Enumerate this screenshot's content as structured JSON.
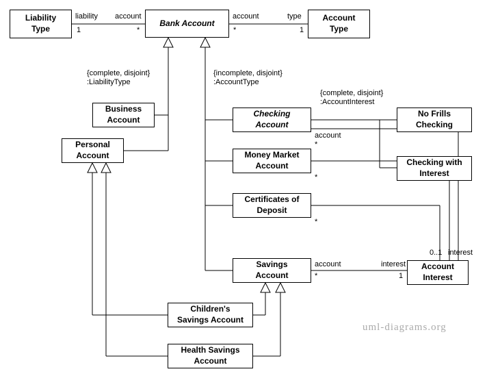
{
  "classes": {
    "liability_type": "Liability<br>Type",
    "bank_account": "Bank Account",
    "account_type": "Account<br>Type",
    "business_account": "Business<br>Account",
    "personal_account": "Personal<br>Account",
    "checking_account": "Checking<br>Account",
    "money_market": "Money Market<br>Account",
    "cert_deposit": "Certificates of<br>Deposit",
    "savings_account": "Savings<br>Account",
    "no_frills": "No Frills<br>Checking",
    "checking_interest": "Checking with<br>Interest",
    "account_interest": "Account<br>Interest",
    "children_savings": "Children's<br>Savings Account",
    "health_savings": "Health Savings<br>Account"
  },
  "labels": {
    "liability": "liability",
    "account": "account",
    "type": "type",
    "interest": "interest",
    "one": "1",
    "star": "*",
    "zero_one": "0..1",
    "gset1": "{complete, disjoint}<br>:LiabilityType",
    "gset2": "{incomplete, disjoint}<br>:AccountType",
    "gset3": "{complete, disjoint}<br>:AccountInterest"
  },
  "watermark": "uml-diagrams.org"
}
